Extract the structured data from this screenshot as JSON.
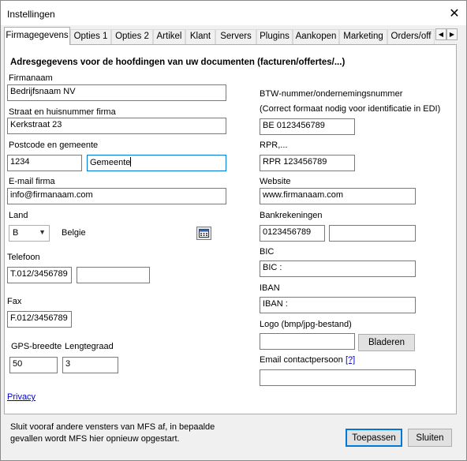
{
  "window": {
    "title": "Instellingen"
  },
  "tabs": [
    {
      "label": "Firmagegevens",
      "active": true
    },
    {
      "label": "Opties 1"
    },
    {
      "label": "Opties 2"
    },
    {
      "label": "Artikel"
    },
    {
      "label": "Klant"
    },
    {
      "label": "Servers"
    },
    {
      "label": "Plugins"
    },
    {
      "label": "Aankopen"
    },
    {
      "label": "Marketing"
    },
    {
      "label": "Orders/off"
    }
  ],
  "tab_scroll": {
    "left": "◀",
    "right": "▶"
  },
  "form": {
    "heading": "Adresgegevens voor de hoofdingen van uw documenten (facturen/offertes/...)",
    "company_name": {
      "label": "Firmanaam",
      "value": "Bedrijfsnaam NV"
    },
    "street": {
      "label": "Straat en huisnummer firma",
      "value": "Kerkstraat 23"
    },
    "postcode_city": {
      "label": "Postcode en gemeente",
      "postcode": "1234",
      "city": "Gemeente"
    },
    "email": {
      "label": "E-mail firma",
      "value": "info@firmanaam.com"
    },
    "country": {
      "label": "Land",
      "code": "B",
      "name": "Belgie"
    },
    "phone": {
      "label": "Telefoon",
      "value": "T.012/3456789",
      "value2": ""
    },
    "fax": {
      "label": "Fax",
      "value": "F.012/3456789"
    },
    "gps": {
      "lat_label": "GPS-breedte",
      "lon_label": "Lengtegraad",
      "lat": "50",
      "lon": "3"
    },
    "privacy_link": "Privacy",
    "vat": {
      "label": "BTW-nummer/ondernemingsnummer",
      "note": "(Correct formaat nodig voor identificatie in EDI)",
      "value": "BE 0123456789"
    },
    "rpr": {
      "label": "RPR,...",
      "value": "RPR 123456789"
    },
    "website": {
      "label": "Website",
      "value": "www.firmanaam.com"
    },
    "bank": {
      "label": "Bankrekeningen",
      "value1": "0123456789",
      "value2": ""
    },
    "bic": {
      "label": "BIC",
      "value": "BIC :"
    },
    "iban": {
      "label": "IBAN",
      "value": "IBAN :"
    },
    "logo": {
      "label": "Logo (bmp/jpg-bestand)",
      "value": "",
      "browse": "Bladeren"
    },
    "contact_email": {
      "label": "Email contactpersoon",
      "help": "[?]",
      "value": ""
    }
  },
  "footer": {
    "note": "Sluit vooraf andere vensters van MFS af, in bepaalde gevallen wordt MFS hier opnieuw opgestart.",
    "apply": "Toepassen",
    "close": "Sluiten"
  }
}
